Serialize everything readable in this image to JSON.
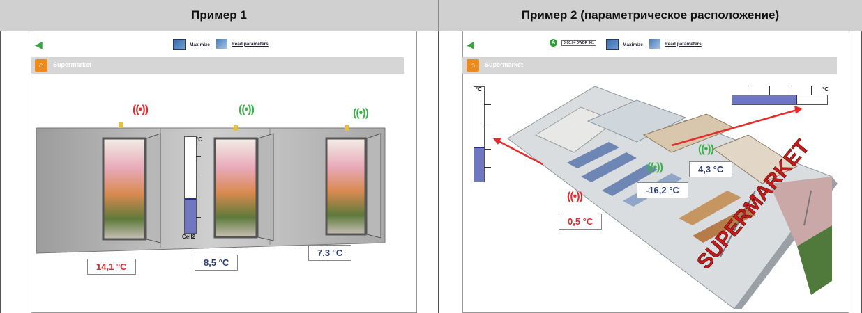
{
  "headers": {
    "col1": "Пример 1",
    "col2": "Пример 2 (параметрическое расположение)"
  },
  "p1": {
    "toolbar": {
      "maximize": "Maximize",
      "read_params": "Read parameters"
    },
    "title": "Supermarket",
    "temps": [
      "14,1 °C",
      "8,5 °C",
      "7,3 °C"
    ],
    "gauge": {
      "unit": "°C",
      "label": "Cell2",
      "level_fraction": 0.35
    },
    "wifi": "((•))"
  },
  "p2": {
    "toolbar": {
      "status": "0:00:04 DWDR 901",
      "maximize": "Maximize",
      "read_params": "Read parameters"
    },
    "title": "Supermarket",
    "temps": [
      "0,5 °C",
      "-16,2 °C",
      "4,3 °C"
    ],
    "gauge_v": {
      "unit": "°C",
      "level_fraction": 0.35
    },
    "gauge_h": {
      "unit": "°C",
      "level_fraction": 0.67
    },
    "sign": "SUPERMARKET",
    "wifi": "((•))"
  }
}
